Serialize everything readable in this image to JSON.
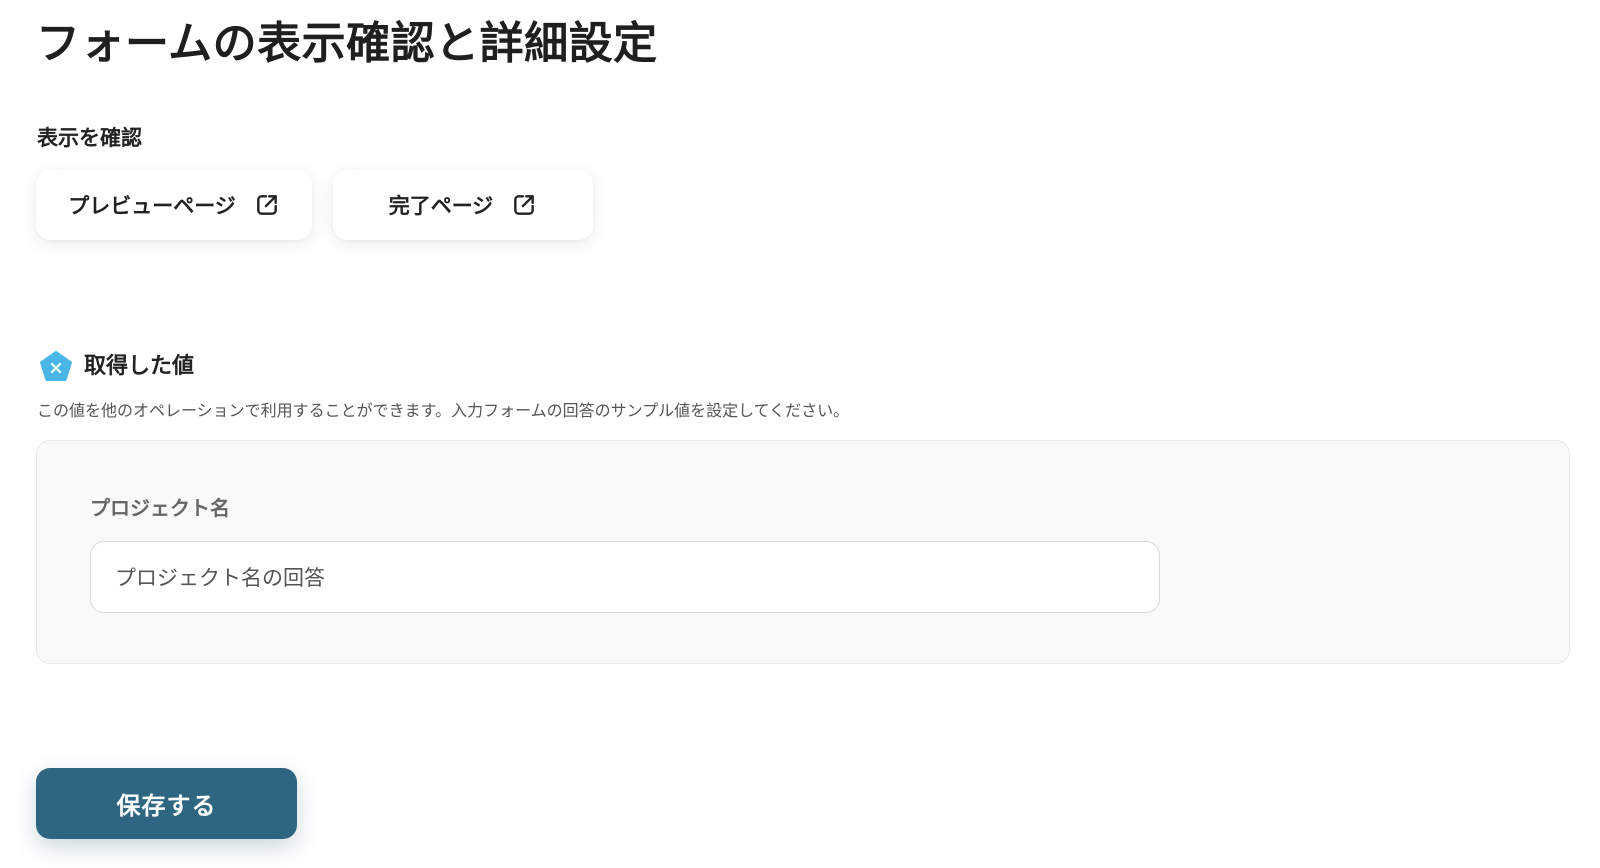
{
  "page": {
    "title": "フォームの表示確認と詳細設定"
  },
  "display_check": {
    "label": "表示を確認",
    "preview_label": "プレビューページ",
    "complete_label": "完了ページ",
    "icon": "external-link-icon"
  },
  "retrieved_values": {
    "title": "取得した値",
    "icon": "pentagon-x-icon",
    "icon_color": "#4ab6e8",
    "description": "この値を他のオペレーションで利用することができます。入力フォームの回答のサンプル値を設定してください。",
    "fields": [
      {
        "label": "プロジェクト名",
        "value": "プロジェクト名の回答"
      }
    ]
  },
  "actions": {
    "save_label": "保存する",
    "save_color": "#2e6580"
  }
}
